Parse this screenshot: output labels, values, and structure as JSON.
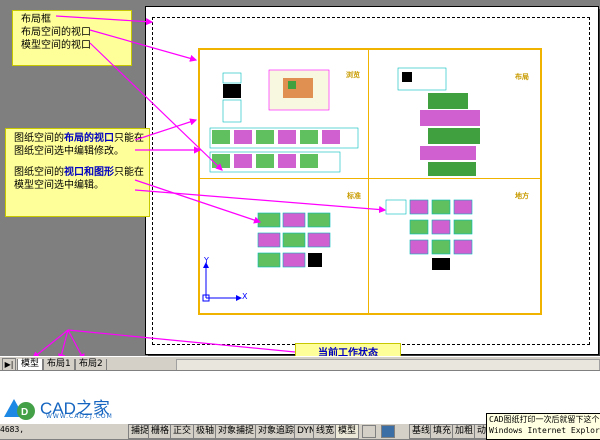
{
  "annotations": {
    "top_note": [
      "布局框",
      "布局空间的视口",
      "模型空间的视口"
    ],
    "middle_note_1": {
      "prefix": "图纸空间的",
      "highlight": "布局的视口",
      "suffix": "只能在图纸空间选中编辑修改。"
    },
    "middle_note_2": {
      "prefix": "图纸空间的",
      "highlight": "视口和图形",
      "suffix": "只能在模型空间选中编辑。"
    },
    "status_note": "当前工作状态"
  },
  "viewport_titles": [
    "浏览",
    "布局",
    "标准",
    "地方"
  ],
  "ucs": {
    "x_label": "X",
    "y_label": "Y"
  },
  "tabs": {
    "nav": "▶|",
    "items": [
      "模型",
      "布局1",
      "布局2"
    ],
    "active": "模型"
  },
  "command_line": {
    "left_number": "4683,",
    "logo_name": "CAD之家",
    "logo_url": "WWW.CADZJ.COM"
  },
  "status_buttons": [
    "捕捉",
    "栅格",
    "正交",
    "极轴",
    "对象捕捉",
    "对象追踪",
    "DYN",
    "线宽",
    "模型"
  ],
  "status_right": [
    "基线",
    "填充",
    "加粗",
    "动"
  ],
  "tooltip": [
    "CAD图纸打印一次后就留下这个",
    "Windows Internet Explorer"
  ],
  "colors": {
    "accent": "#ff00ff",
    "viewport_border": "#f0b400",
    "note_bg": "#ffff99"
  }
}
